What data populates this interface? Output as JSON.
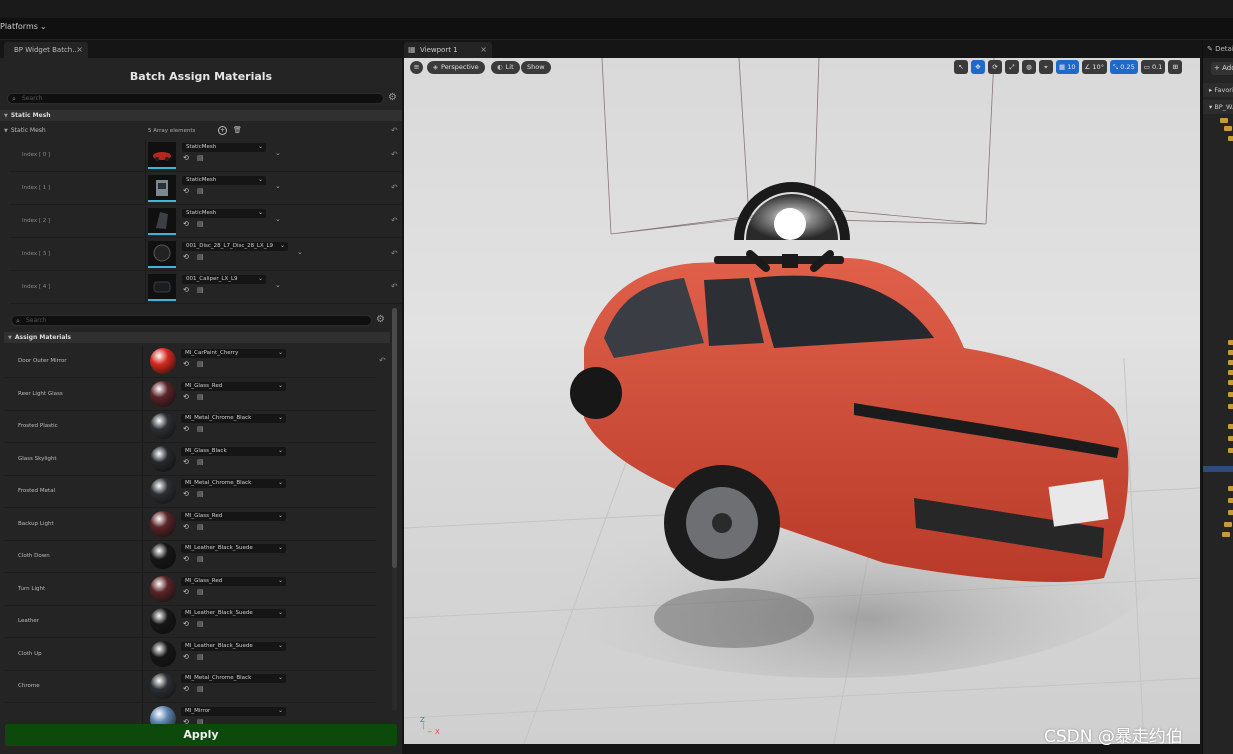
{
  "menubar": {
    "platforms_label": "Platforms"
  },
  "left_panel": {
    "tab_title": "BP Widget Batch...",
    "title": "Batch Assign Materials",
    "search1_placeholder": "Search",
    "search2_placeholder": "Search",
    "category_static_mesh": "Static Mesh",
    "static_mesh_prop_label": "Static Mesh",
    "array_count": "5 Array elements",
    "array_items": [
      {
        "index_label": "Index [ 0 ]",
        "value": "StaticMesh"
      },
      {
        "index_label": "Index [ 1 ]",
        "value": "StaticMesh"
      },
      {
        "index_label": "Index [ 2 ]",
        "value": "StaticMesh"
      },
      {
        "index_label": "Index [ 3 ]",
        "value": "001_Disc_28_L7_Disc_28_LX_L9"
      },
      {
        "index_label": "Index [ 4 ]",
        "value": "001_Caliper_LX_L9"
      }
    ],
    "category_assign_materials": "Assign Materials",
    "materials": [
      {
        "label": "Door Outer Mirror",
        "value": "MI_CarPaint_Cherry",
        "color": "#d42a1e"
      },
      {
        "label": "Reer Light Glass",
        "value": "MI_Glass_Red",
        "color": "#5a2428"
      },
      {
        "label": "Frosted Plastic",
        "value": "MI_Metal_Chrome_Black",
        "color": "#2c3034"
      },
      {
        "label": "Glass Skylight",
        "value": "MI_Glass_Black",
        "color": "#26292c"
      },
      {
        "label": "Frosted Metal",
        "value": "MI_Metal_Chrome_Black",
        "color": "#2c3034"
      },
      {
        "label": "Backup Light",
        "value": "MI_Glass_Red",
        "color": "#5a2428"
      },
      {
        "label": "Cloth Down",
        "value": "MI_Leather_Black_Suede",
        "color": "#161616"
      },
      {
        "label": "Turn Light",
        "value": "MI_Glass_Red",
        "color": "#5a2428"
      },
      {
        "label": "Leather",
        "value": "MI_Leather_Black_Suede",
        "color": "#161616"
      },
      {
        "label": "Cloth Up",
        "value": "MI_Leather_Black_Suede",
        "color": "#161616"
      },
      {
        "label": "Chrome",
        "value": "MI_Metal_Chrome_Black",
        "color": "#2c3034"
      },
      {
        "label": "",
        "value": "MI_Mirror",
        "color": "#5d86b3"
      }
    ],
    "apply_label": "Apply",
    "apply_color": "#0c4a0c"
  },
  "viewport": {
    "tab_title": "Viewport 1",
    "perspective_label": "Perspective",
    "lit_label": "Lit",
    "show_label": "Show",
    "grid_snap": "10",
    "rotation_snap": "10°",
    "scale_snap": "0.25",
    "camera_speed": "0.1",
    "axis_x": "X",
    "axis_z": "Z",
    "car_color": "#d9533c"
  },
  "right_panel": {
    "tab_title": "Details",
    "add_label": "+ Add",
    "favorites_label": "Favorites",
    "bp_label": "BP_W..."
  },
  "watermark": "CSDN @暴走约伯"
}
